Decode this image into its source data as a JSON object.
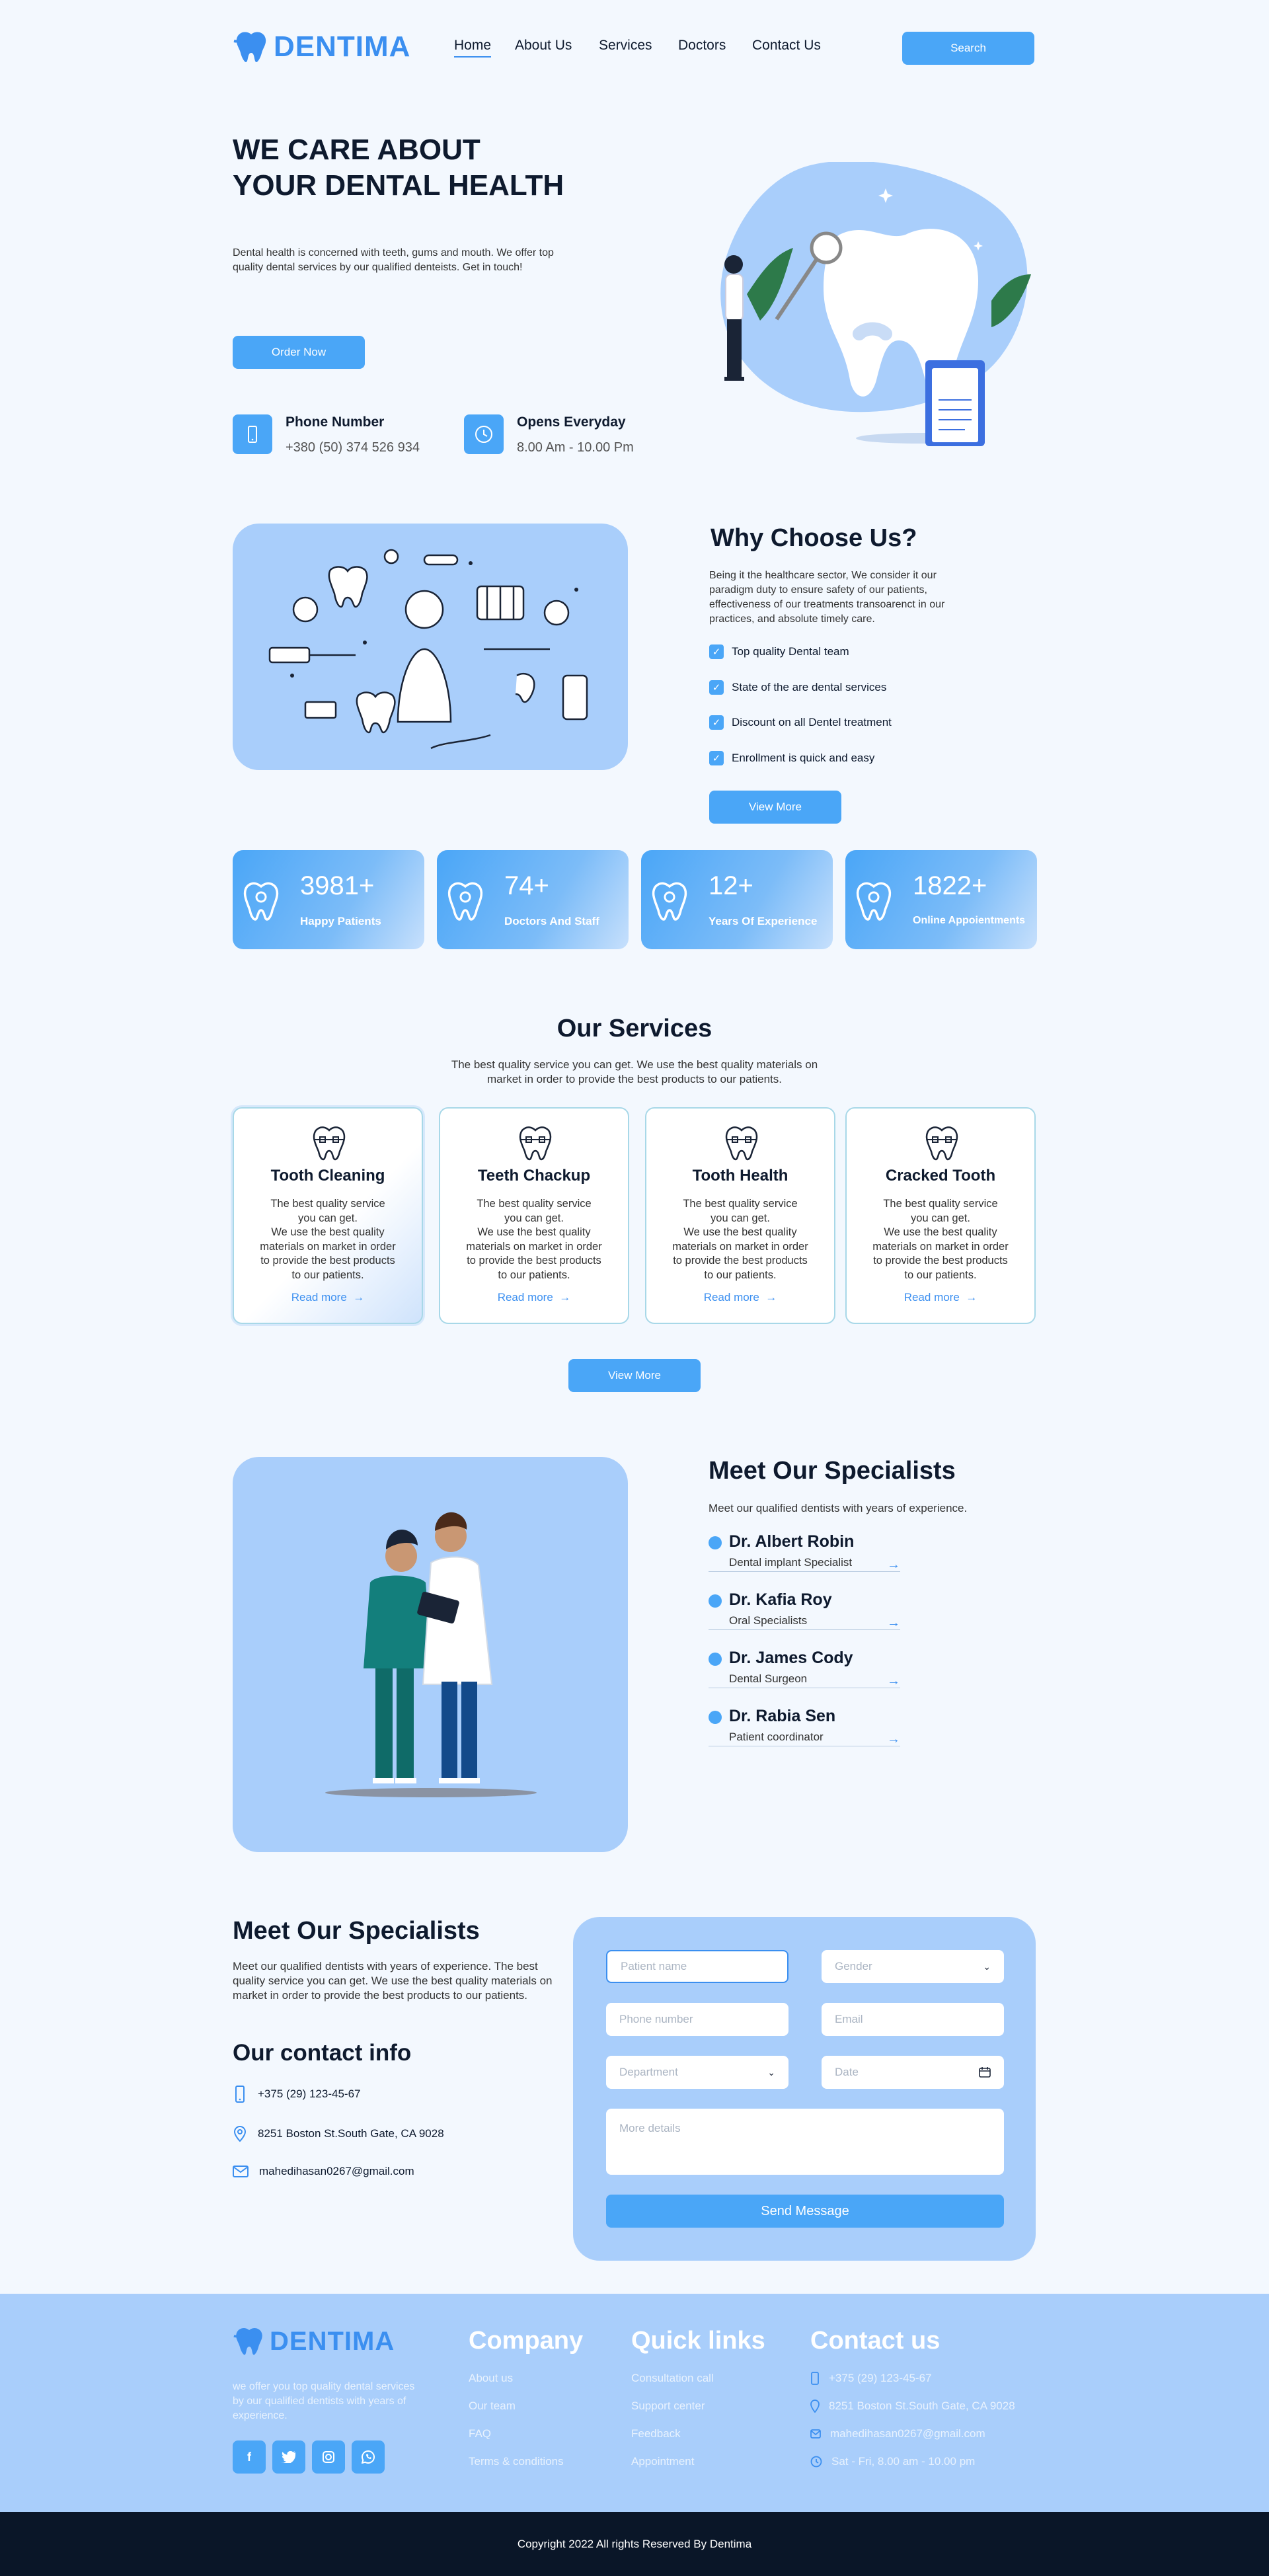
{
  "brand": {
    "name": "DENTIMA",
    "color": "#3b8ff0"
  },
  "nav": {
    "items": [
      "Home",
      "About Us",
      "Services",
      "Doctors",
      "Contact Us"
    ],
    "search_label": "Search"
  },
  "hero": {
    "title_line1": "WE CARE ABOUT",
    "title_line2": "YOUR DENTAL HEALTH",
    "text": "Dental health is concerned with teeth, gums and mouth. We offer top quality dental services by our qualified denteists. Get in touch!",
    "button": "Order Now",
    "phone_label": "Phone Number",
    "phone_value": "+380 (50) 374 526 934",
    "hours_label": "Opens Everyday",
    "hours_value": "8.00 Am - 10.00 Pm"
  },
  "why": {
    "title": "Why Choose Us?",
    "text": "Being it the healthcare sector, We consider it our paradigm duty to ensure safety of our patients, effectiveness of our treatments transoarenct in our practices, and absolute timely care.",
    "items": [
      "Top quality Dental team",
      "State of the are dental services",
      "Discount on all Dentel treatment",
      "Enrollment is quick and easy"
    ],
    "button": "View More"
  },
  "stats": [
    {
      "value": "3981+",
      "label": "Happy Patients"
    },
    {
      "value": "74+",
      "label": "Doctors And Staff"
    },
    {
      "value": "12+",
      "label": "Years Of Experience"
    },
    {
      "value": "1822+",
      "label": "Online Appoientments"
    }
  ],
  "services": {
    "title": "Our Services",
    "subtitle": "The best quality service you can get. We use the best quality materials on market in order to provide the best products to our patients.",
    "cards": [
      {
        "title": "Tooth Cleaning",
        "text": "The best quality service\nyou can get.\nWe use the best quality materials on market in order to provide the best products to our patients.",
        "link": "Read more"
      },
      {
        "title": "Teeth Chackup",
        "text": "The best quality service\nyou can get.\nWe use the best quality materials on market in order to provide the best products to our patients.",
        "link": "Read more"
      },
      {
        "title": "Tooth Health",
        "text": "The best quality service\nyou can get.\nWe use the best quality materials on market in order to provide the best products to our patients.",
        "link": "Read more"
      },
      {
        "title": "Cracked Tooth",
        "text": "The best quality service\nyou can get.\nWe use the best quality materials on market in order to provide the best products to our patients.",
        "link": "Read more"
      }
    ],
    "button": "View More"
  },
  "specialists": {
    "title": "Meet Our Specialists",
    "subtitle": "Meet our qualified dentists with years of experience.",
    "list": [
      {
        "name": "Dr. Albert Robin",
        "role": "Dental implant Specialist"
      },
      {
        "name": "Dr. Kafia Roy",
        "role": "Oral Specialists"
      },
      {
        "name": "Dr. James Cody",
        "role": "Dental Surgeon"
      },
      {
        "name": "Dr. Rabia Sen",
        "role": "Patient coordinator"
      }
    ]
  },
  "contact": {
    "title": "Meet Our Specialists",
    "text": "Meet our qualified dentists with years of experience. The best quality service you can get. We use the best quality materials on market in order to provide the best products to our patients.",
    "info_title": "Our contact info",
    "phone": "+375 (29) 123-45-67",
    "address": "8251 Boston St.South Gate, CA 9028",
    "email": "mahedihasan0267@gmail.com"
  },
  "form": {
    "patient_name": "Patient name",
    "gender": "Gender",
    "phone": "Phone number",
    "email": "Email",
    "department": "Department",
    "date": "Date",
    "details": "More details",
    "submit": "Send Message"
  },
  "footer": {
    "tagline": "we offer you top quality dental services by our qualified dentists with years of experience.",
    "company_title": "Company",
    "company_links": [
      "About us",
      "Our team",
      "FAQ",
      "Terms & conditions"
    ],
    "quick_title": "Quick links",
    "quick_links": [
      "Consultation call",
      "Support center",
      "Feedback",
      "Appointment"
    ],
    "contact_title": "Contact us",
    "contact_phone": "+375 (29) 123-45-67",
    "contact_address": "8251 Boston St.South Gate, CA 9028",
    "contact_email": "mahedihasan0267@gmail.com",
    "contact_hours": "Sat - Fri, 8.00 am - 10.00 pm",
    "copyright": "Copyright 2022 All rights Reserved By Dentima"
  }
}
